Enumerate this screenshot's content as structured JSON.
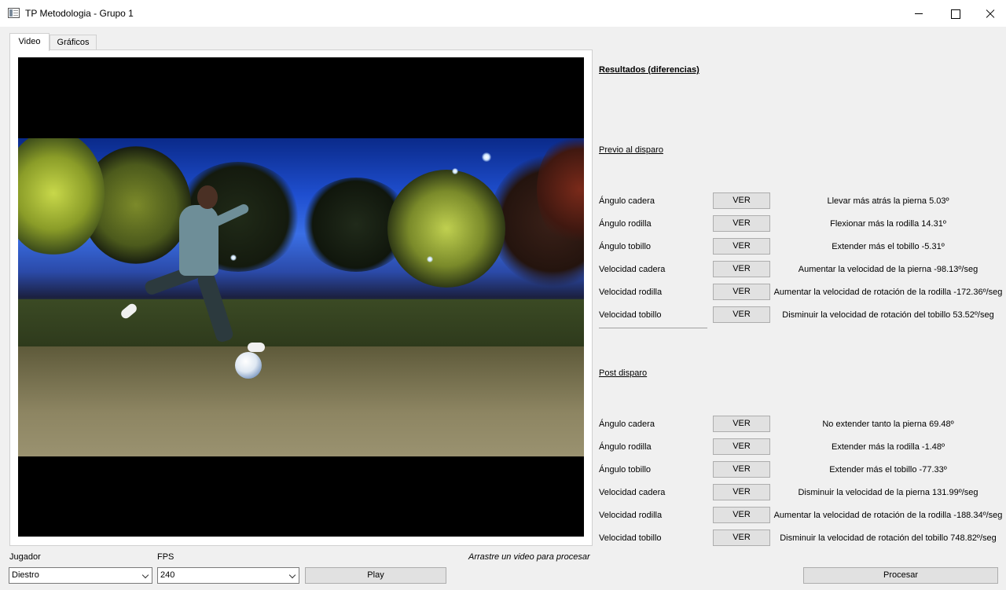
{
  "window": {
    "title": "TP Metodologia - Grupo 1"
  },
  "tabs": [
    {
      "label": "Video",
      "active": true
    },
    {
      "label": "Gráficos",
      "active": false
    }
  ],
  "results": {
    "title": "Resultados (diferencias)",
    "button_label": "VER",
    "pre": {
      "title": "Previo al disparo",
      "rows": [
        {
          "label": "Ángulo cadera",
          "result": "Llevar más atrás la pierna 5.03º"
        },
        {
          "label": "Ángulo rodilla",
          "result": "Flexionar más la rodilla 14.31º"
        },
        {
          "label": "Ángulo tobillo",
          "result": "Extender más el tobillo -5.31º"
        },
        {
          "label": "Velocidad cadera",
          "result": "Aumentar la velocidad de la pierna -98.13º/seg"
        },
        {
          "label": "Velocidad rodilla",
          "result": "Aumentar la velocidad de rotación de la rodilla -172.36º/seg"
        },
        {
          "label": "Velocidad tobillo",
          "result": "Disminuir la velocidad de rotación del tobillo 53.52º/seg"
        }
      ]
    },
    "post": {
      "title": "Post disparo",
      "rows": [
        {
          "label": "Ángulo cadera",
          "result": "No extender tanto la pierna 69.48º"
        },
        {
          "label": "Ángulo rodilla",
          "result": "Extender más la rodilla -1.48º"
        },
        {
          "label": "Ángulo tobillo",
          "result": "Extender más el tobillo -77.33º"
        },
        {
          "label": "Velocidad cadera",
          "result": "Disminuir la velocidad de la pierna 131.99º/seg"
        },
        {
          "label": "Velocidad rodilla",
          "result": "Aumentar la velocidad de rotación de la rodilla -188.34º/seg"
        },
        {
          "label": "Velocidad tobillo",
          "result": "Disminuir la velocidad de rotación del tobillo 748.82º/seg"
        }
      ]
    }
  },
  "controls": {
    "jugador_label": "Jugador",
    "jugador_value": "Diestro",
    "fps_label": "FPS",
    "fps_value": "240",
    "play_label": "Play",
    "hint": "Arrastre un video para procesar",
    "procesar_label": "Procesar"
  },
  "icons": {
    "app": "app-window-icon",
    "minimize": "minimize-icon",
    "maximize": "maximize-icon",
    "close": "close-icon",
    "dropdown": "chevron-down-icon"
  }
}
